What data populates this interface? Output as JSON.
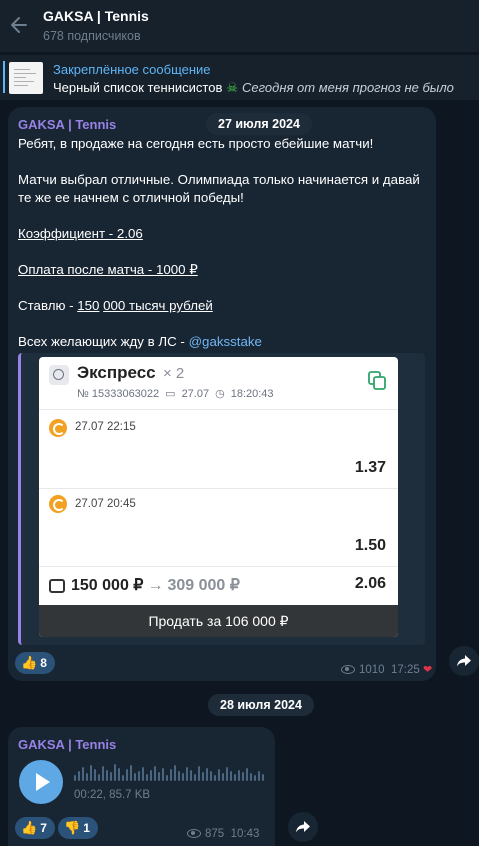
{
  "header": {
    "title": "GAKSA | Tennis",
    "subtitle": "678 подписчиков"
  },
  "pinned": {
    "title": "Закреплённое сообщение",
    "text": "Черный список теннисистов",
    "emoji": "☠",
    "preview": "Сегодня от меня прогноз не было"
  },
  "message1": {
    "sender": "GAKSA | Tennis",
    "date": "27 июля 2024",
    "line1": "Ребят, в продаже на сегодня есть просто ебейшие матчи!",
    "line2": "Матчи выбрал отличные. Олимпиада только начинается и давай те же ее начнем с отличной победы!",
    "coef": "Коэффициент - 2.06",
    "payment": "Оплата после матча - 1000 ₽",
    "stake_prefix": "Ставлю - ",
    "stake_a": "150",
    "stake_b": "000 тысяч рублей",
    "contact_prefix": "Всех желающих жду в ЛС - ",
    "mention": "@gaksstake",
    "reaction_emoji": "👍",
    "reaction_count": "8",
    "views": "1010",
    "time": "17:25",
    "heart": "❤"
  },
  "bet_card": {
    "title": "Экспресс",
    "multiplier": "× 2",
    "number": "№ 15333063022",
    "date": "27.07",
    "time": "18:20:43",
    "events": [
      {
        "datetime": "27.07   22:15",
        "odd": "1.37"
      },
      {
        "datetime": "27.07   20:45",
        "odd": "1.50"
      }
    ],
    "stake": "150 000 ₽",
    "arrow": "→",
    "win": "309 000 ₽",
    "total_odd": "2.06",
    "sell_label": "Продать за 106 000 ₽"
  },
  "date_separator": "28 июля 2024",
  "message2": {
    "sender": "GAKSA | Tennis",
    "voice_meta": "00:22, 85.7 KB",
    "reactions": [
      {
        "emoji": "👍",
        "count": "7"
      },
      {
        "emoji": "👎",
        "count": "1"
      }
    ],
    "views": "875",
    "time": "10:43"
  }
}
